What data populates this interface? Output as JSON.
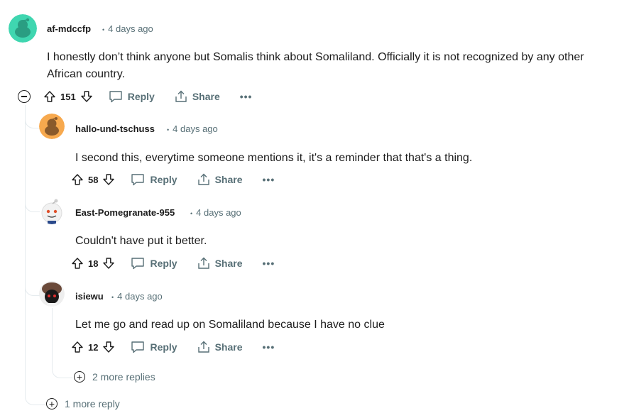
{
  "comment": {
    "username": "af-mdccfp",
    "time": "4 days ago",
    "body_line1": "I honestly don’t think anyone but Somalis think about Somaliland. Officially it is not recognized by any other",
    "body_line2": "African country.",
    "score": "151",
    "avatar_color": "#3fd6b0"
  },
  "replies": [
    {
      "username": "hallo-und-tschuss",
      "time": "4 days ago",
      "body": "I second this, everytime someone mentions it, it's a reminder that that's a thing.",
      "score": "58",
      "avatar_color": "#f7a94e"
    },
    {
      "username": "East-Pomegranate-955",
      "time": "4 days ago",
      "body": "Couldn't have put it better.",
      "score": "18"
    },
    {
      "username": "isiewu",
      "time": "4 days ago",
      "body": "Let me go and read up on Somaliland because I have no clue",
      "score": "12"
    }
  ],
  "actions": {
    "reply": "Reply",
    "share": "Share",
    "more": "•••",
    "separator": "•"
  },
  "more_replies_nested": "2 more replies",
  "more_replies_top": "1 more reply"
}
